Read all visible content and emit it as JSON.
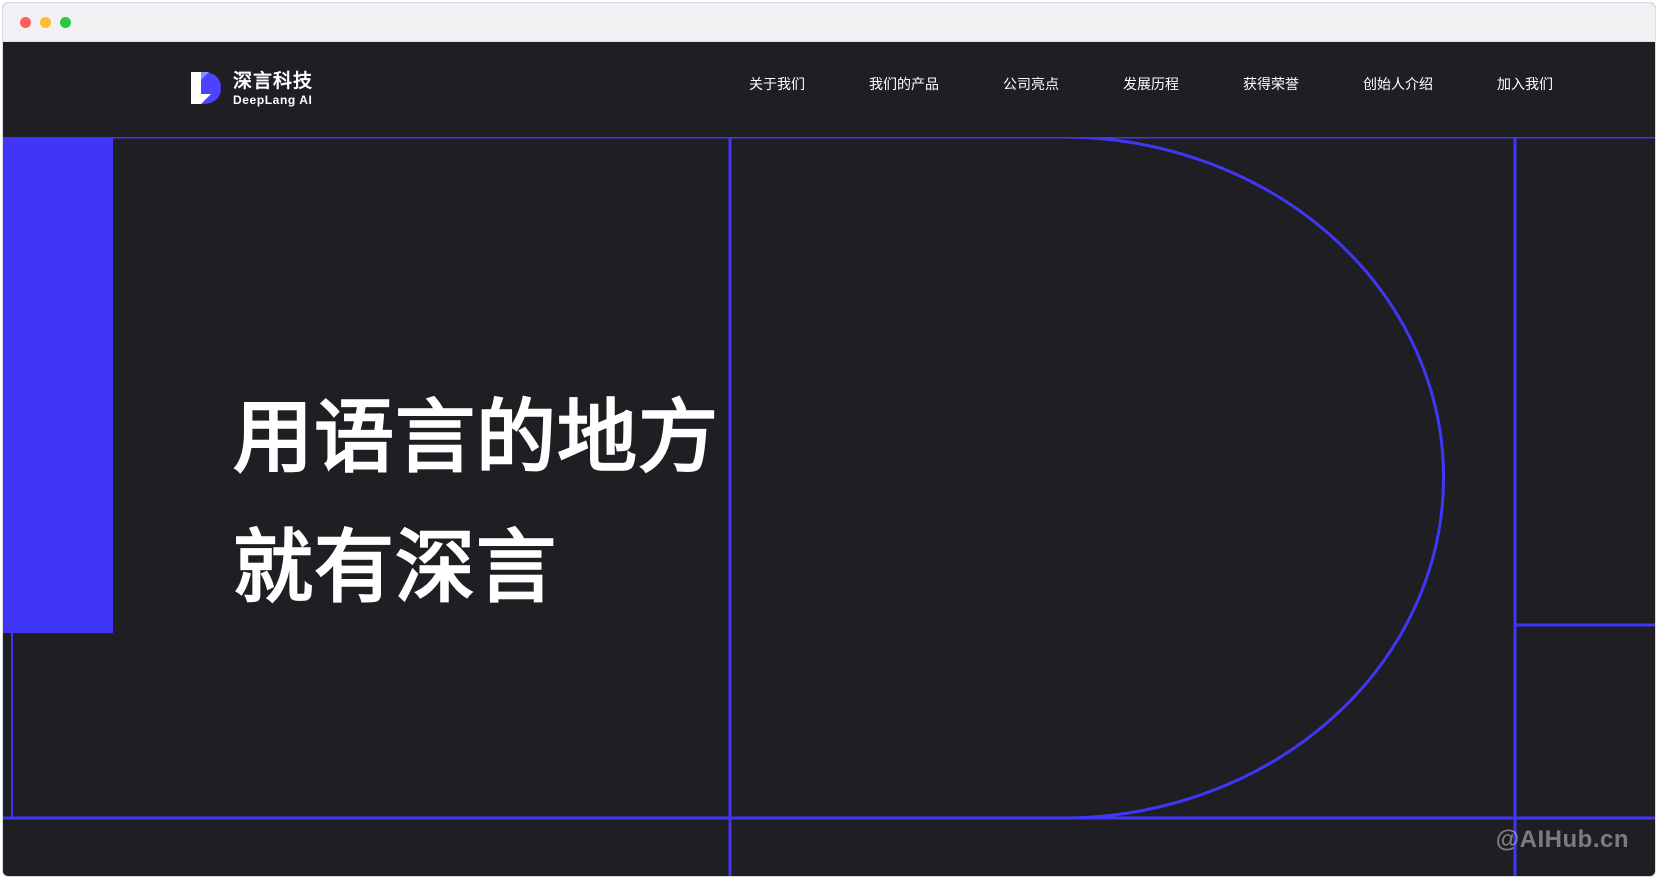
{
  "window": {
    "controls": [
      "close",
      "minimize",
      "zoom"
    ]
  },
  "brand": {
    "name_cn": "深言科技",
    "name_en": "DeepLang AI",
    "logo_icon": "deeplang-d-logo-icon"
  },
  "nav": {
    "items": [
      {
        "label": "关于我们"
      },
      {
        "label": "我们的产品"
      },
      {
        "label": "公司亮点"
      },
      {
        "label": "发展历程"
      },
      {
        "label": "获得荣誉"
      },
      {
        "label": "创始人介绍"
      },
      {
        "label": "加入我们"
      }
    ]
  },
  "hero": {
    "line1": "用语言的地方",
    "line2": "就有深言"
  },
  "watermark": "@AIHub.cn",
  "colors": {
    "background": "#1f1e23",
    "accent": "#4036f5",
    "text": "#ffffff",
    "titlebar": "#f1f1f3"
  }
}
